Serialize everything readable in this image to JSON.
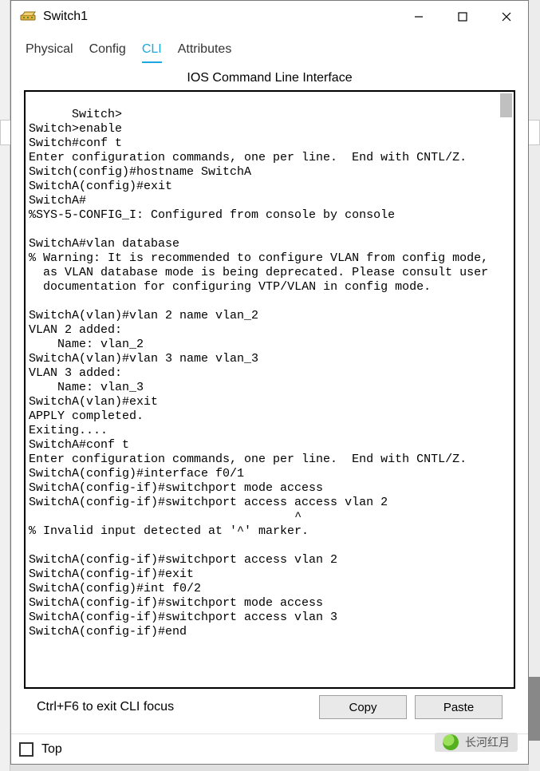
{
  "window": {
    "title": "Switch1"
  },
  "tabs": {
    "items": [
      "Physical",
      "Config",
      "CLI",
      "Attributes"
    ],
    "active_index": 2
  },
  "cli": {
    "header": "IOS Command Line Interface",
    "content": "Switch>\nSwitch>enable\nSwitch#conf t\nEnter configuration commands, one per line.  End with CNTL/Z.\nSwitch(config)#hostname SwitchA\nSwitchA(config)#exit\nSwitchA#\n%SYS-5-CONFIG_I: Configured from console by console\n\nSwitchA#vlan database\n% Warning: It is recommended to configure VLAN from config mode,\n  as VLAN database mode is being deprecated. Please consult user\n  documentation for configuring VTP/VLAN in config mode.\n\nSwitchA(vlan)#vlan 2 name vlan_2\nVLAN 2 added:\n    Name: vlan_2\nSwitchA(vlan)#vlan 3 name vlan_3\nVLAN 3 added:\n    Name: vlan_3\nSwitchA(vlan)#exit\nAPPLY completed.\nExiting....\nSwitchA#conf t\nEnter configuration commands, one per line.  End with CNTL/Z.\nSwitchA(config)#interface f0/1\nSwitchA(config-if)#switchport mode access\nSwitchA(config-if)#switchport access access vlan 2\n                                     ^\n% Invalid input detected at '^' marker.\n\t\nSwitchA(config-if)#switchport access vlan 2\nSwitchA(config-if)#exit\nSwitchA(config)#int f0/2\nSwitchA(config-if)#switchport mode access\nSwitchA(config-if)#switchport access vlan 3\nSwitchA(config-if)#end",
    "hint": "Ctrl+F6 to exit CLI focus",
    "copy_label": "Copy",
    "paste_label": "Paste"
  },
  "bottom": {
    "top_label": "Top",
    "top_checked": false
  },
  "watermark": {
    "text": "长河红月"
  }
}
